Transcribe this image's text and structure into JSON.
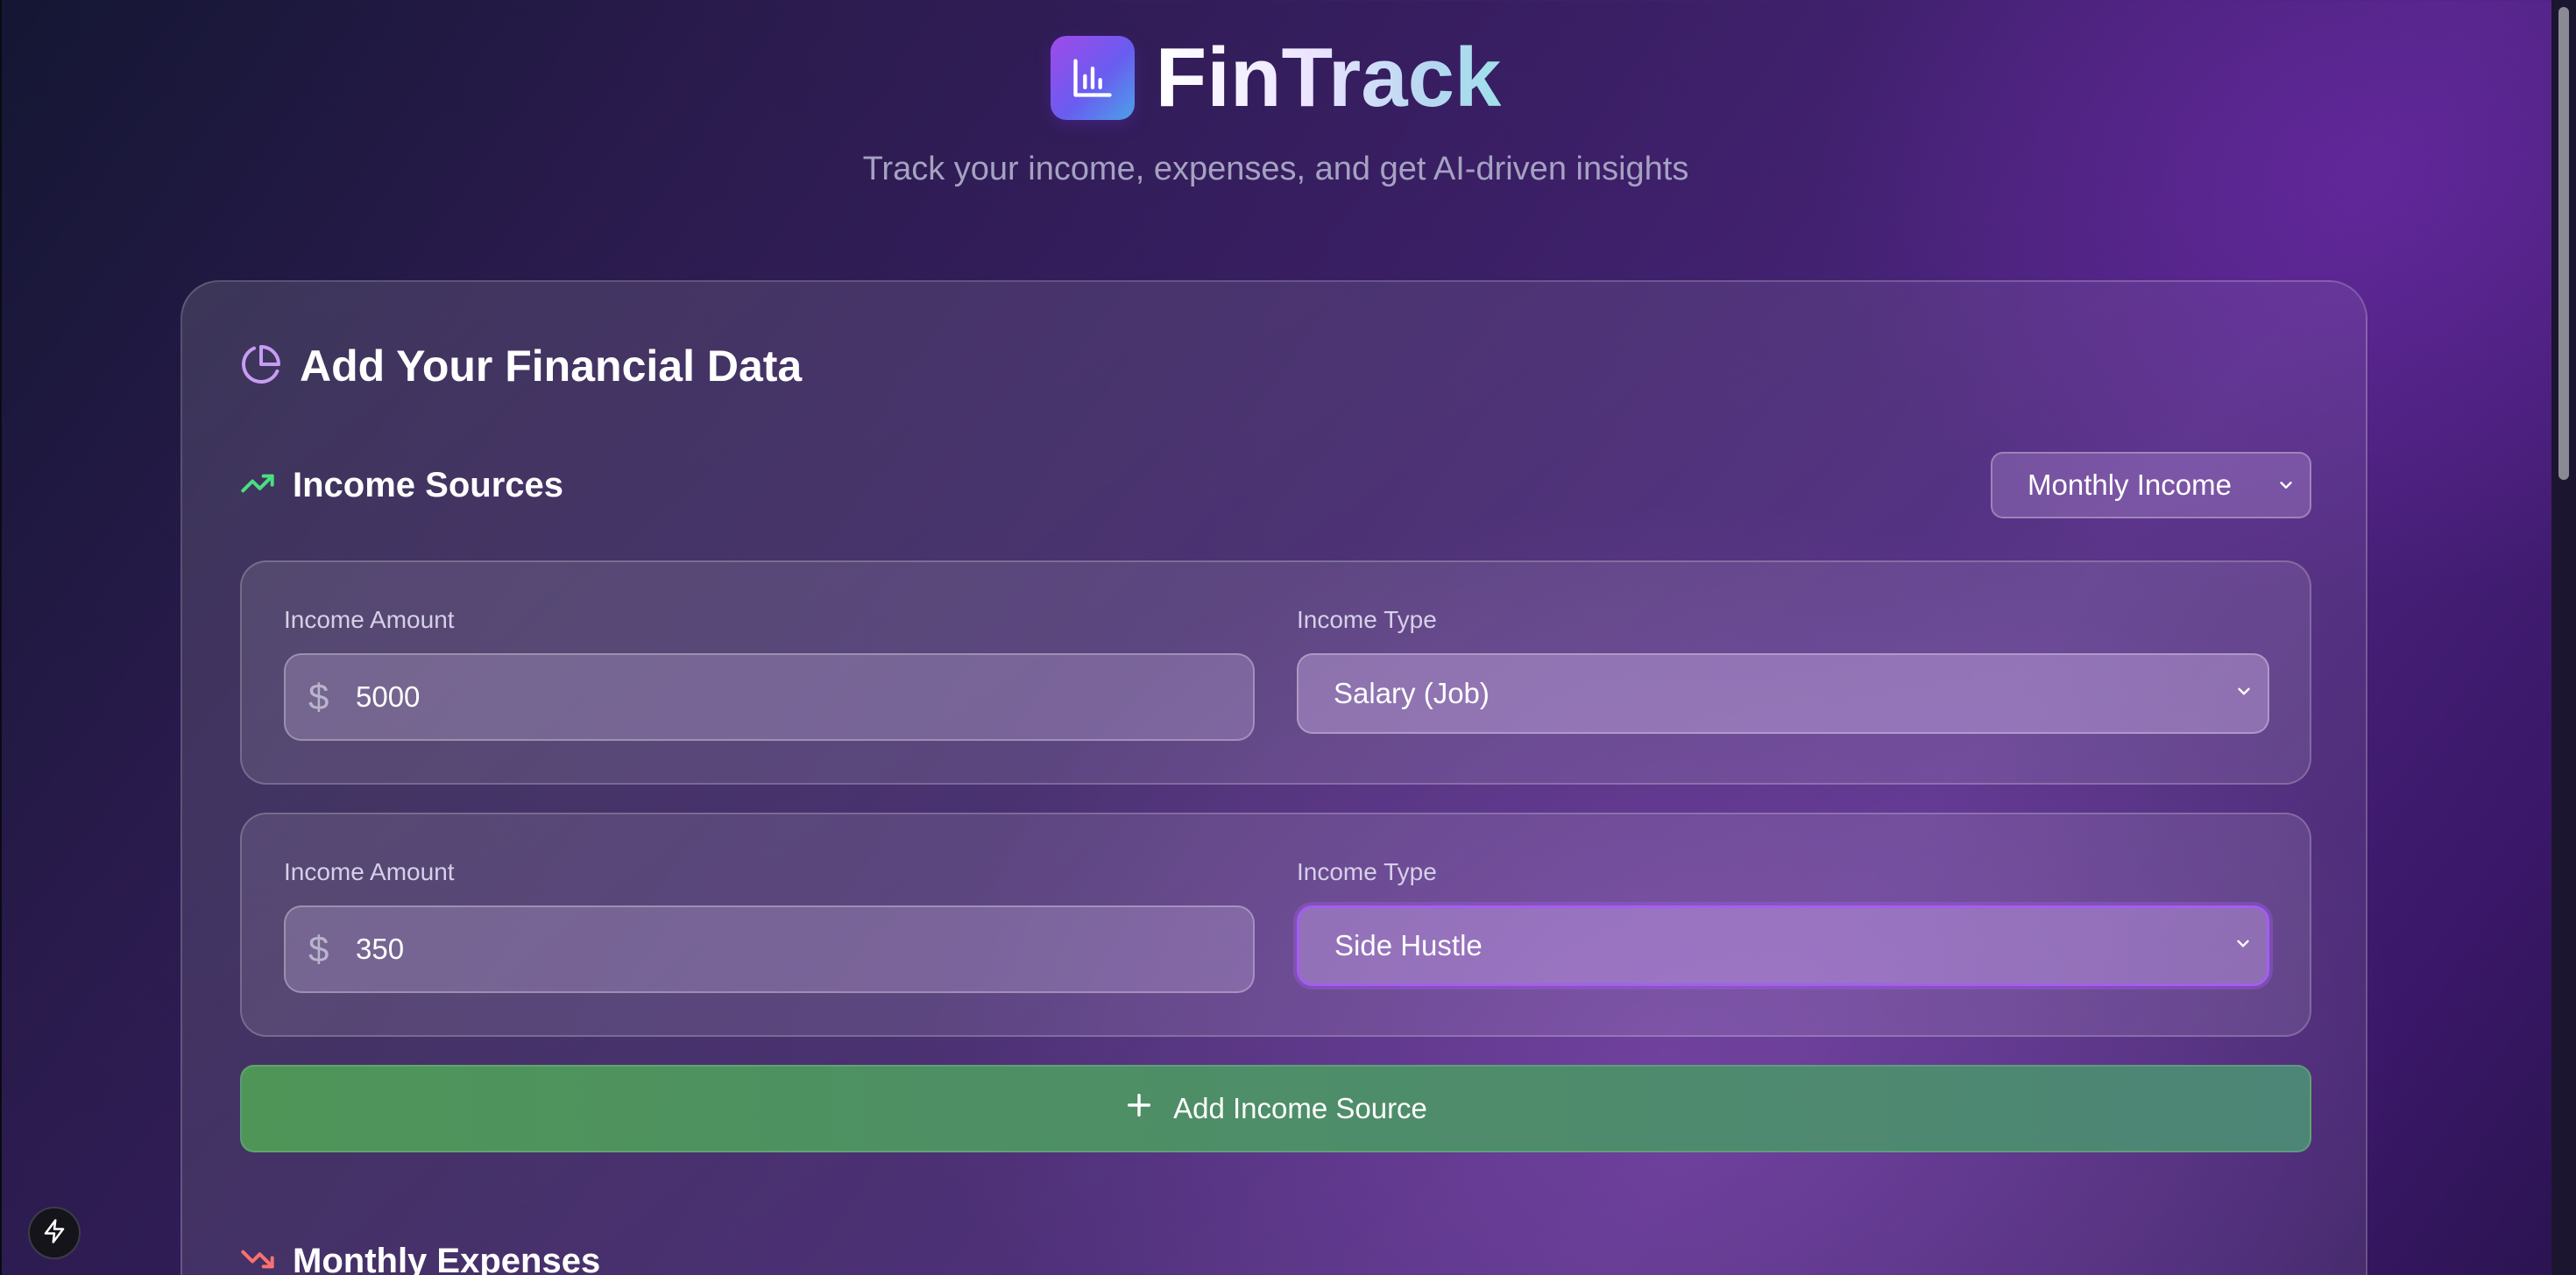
{
  "header": {
    "app_title": "FinTrack",
    "subtitle": "Track your income, expenses, and get AI-driven insights",
    "logo_icon": "bar-chart-icon"
  },
  "card": {
    "title": "Add Your Financial Data",
    "title_icon": "pie-chart-icon"
  },
  "income_section": {
    "title": "Income Sources",
    "icon": "trending-up-icon",
    "period_select_value": "Monthly Income",
    "rows": [
      {
        "amount_label": "Income Amount",
        "currency_symbol": "$",
        "amount": "5000",
        "type_label": "Income Type",
        "type_value": "Salary (Job)"
      },
      {
        "amount_label": "Income Amount",
        "currency_symbol": "$",
        "amount": "350",
        "type_label": "Income Type",
        "type_value": "Side Hustle"
      }
    ],
    "add_button_label": "Add Income Source"
  },
  "expenses_section": {
    "title": "Monthly Expenses",
    "icon": "trending-down-icon"
  },
  "colors": {
    "accent_purple": "#a45ef0",
    "add_button_green": "#4f9558",
    "income_icon_green": "#4ade80",
    "expense_icon_red": "#f87171"
  }
}
